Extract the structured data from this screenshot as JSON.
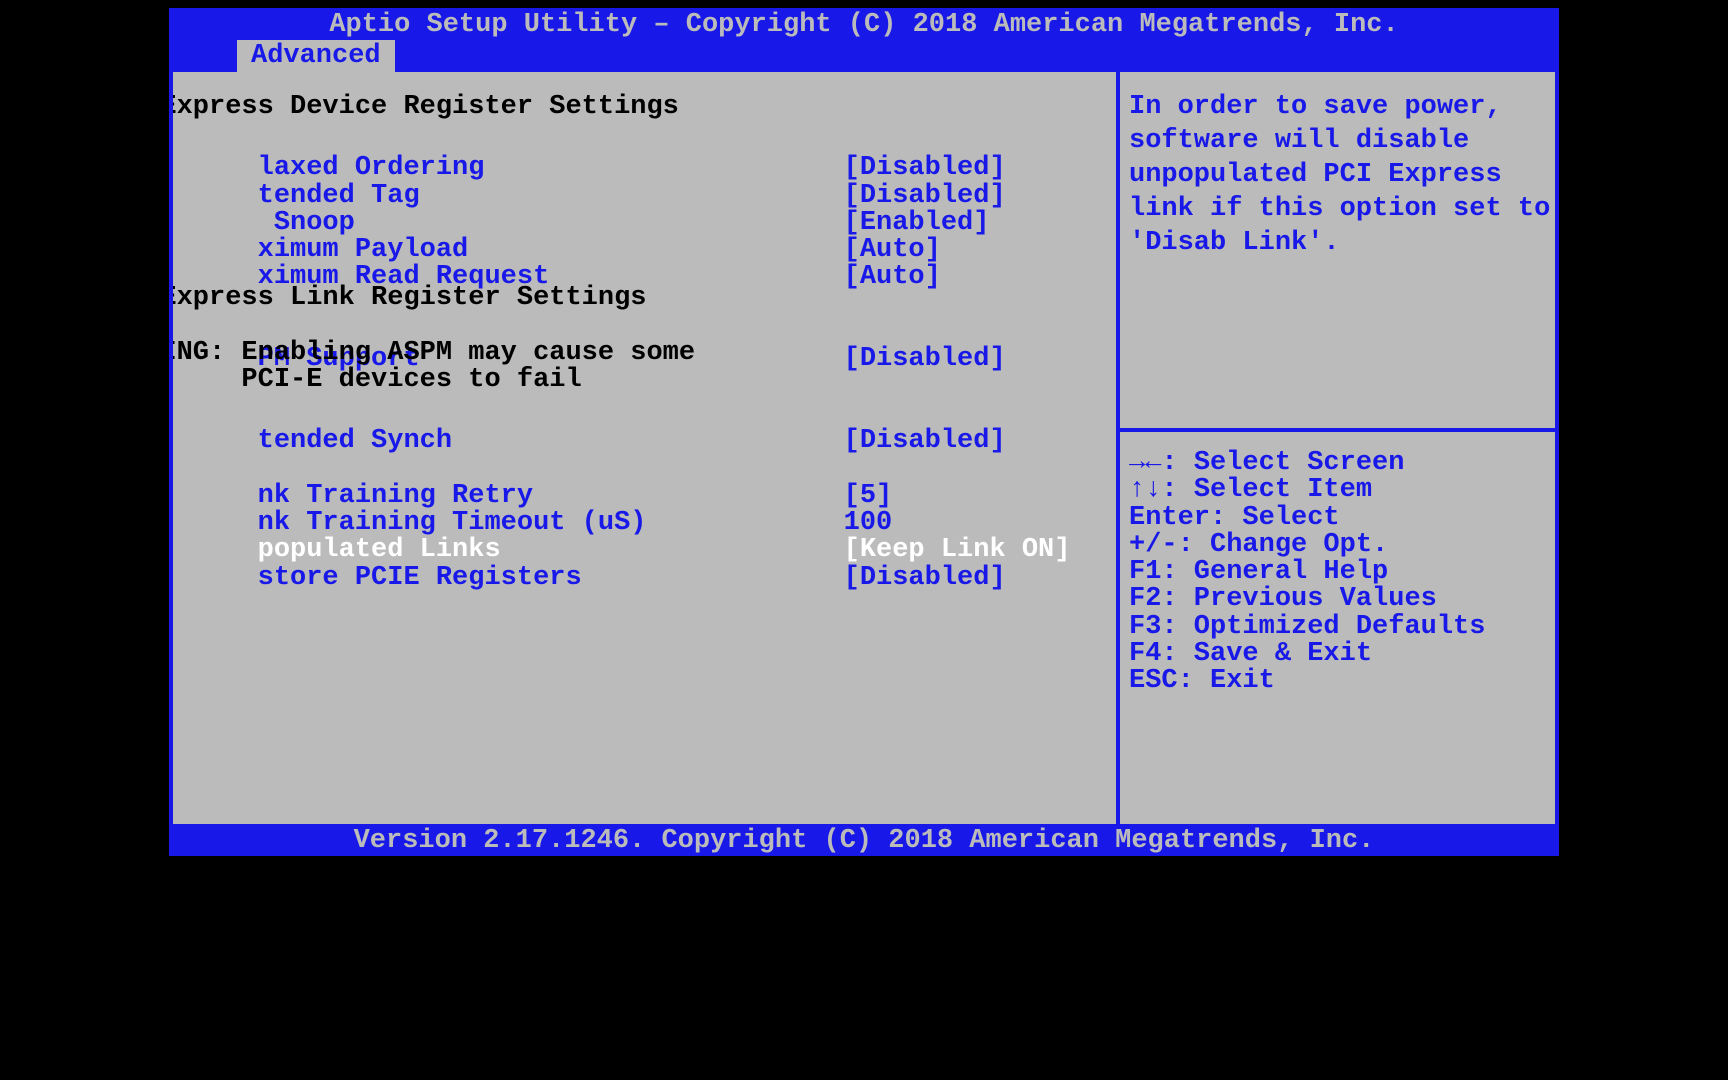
{
  "header": {
    "title": "Aptio Setup Utility – Copyright (C) 2018 American Megatrends, Inc."
  },
  "tab": {
    "active": "Advanced"
  },
  "main": {
    "section1_title": "I Express Device Register Settings",
    "items1": [
      {
        "label": "laxed Ordering",
        "value": "[Disabled]"
      },
      {
        "label": "tended Tag",
        "value": "[Disabled]"
      },
      {
        "label": " Snoop",
        "value": "[Enabled]"
      },
      {
        "label": "ximum Payload",
        "value": "[Auto]"
      },
      {
        "label": "ximum Read Request",
        "value": "[Auto]"
      }
    ],
    "section2_title": "I Express Link Register Settings",
    "aspm": {
      "label": "PM Support",
      "value": "[Disabled]"
    },
    "warn1": "RNING: Enabling ASPM may cause some",
    "warn2": "       PCI-E devices to fail",
    "ext_synch": {
      "label": "tended Synch",
      "value": "[Disabled]"
    },
    "items3": [
      {
        "label": "nk Training Retry",
        "value": "[5]"
      },
      {
        "label": "nk Training Timeout (uS)",
        "value": "100"
      },
      {
        "label": "populated Links",
        "value": "[Keep Link ON]",
        "selected": true
      },
      {
        "label": "store PCIE Registers",
        "value": "[Disabled]"
      }
    ]
  },
  "help": {
    "text": "In order to save power, software will disable unpopulated PCI Express link if this option set to 'Disab Link'."
  },
  "legend": {
    "l1a": "→←: ",
    "l1b": "Select Screen",
    "l2a": "↑↓: ",
    "l2b": "Select Item",
    "l3": "Enter: Select",
    "l4": "+/-: Change Opt.",
    "l5": "F1: General Help",
    "l6": "F2: Previous Values",
    "l7": "F3: Optimized Defaults",
    "l8": "F4: Save & Exit",
    "l9": "ESC: Exit"
  },
  "footer": {
    "text": "Version 2.17.1246. Copyright (C) 2018 American Megatrends, Inc."
  }
}
